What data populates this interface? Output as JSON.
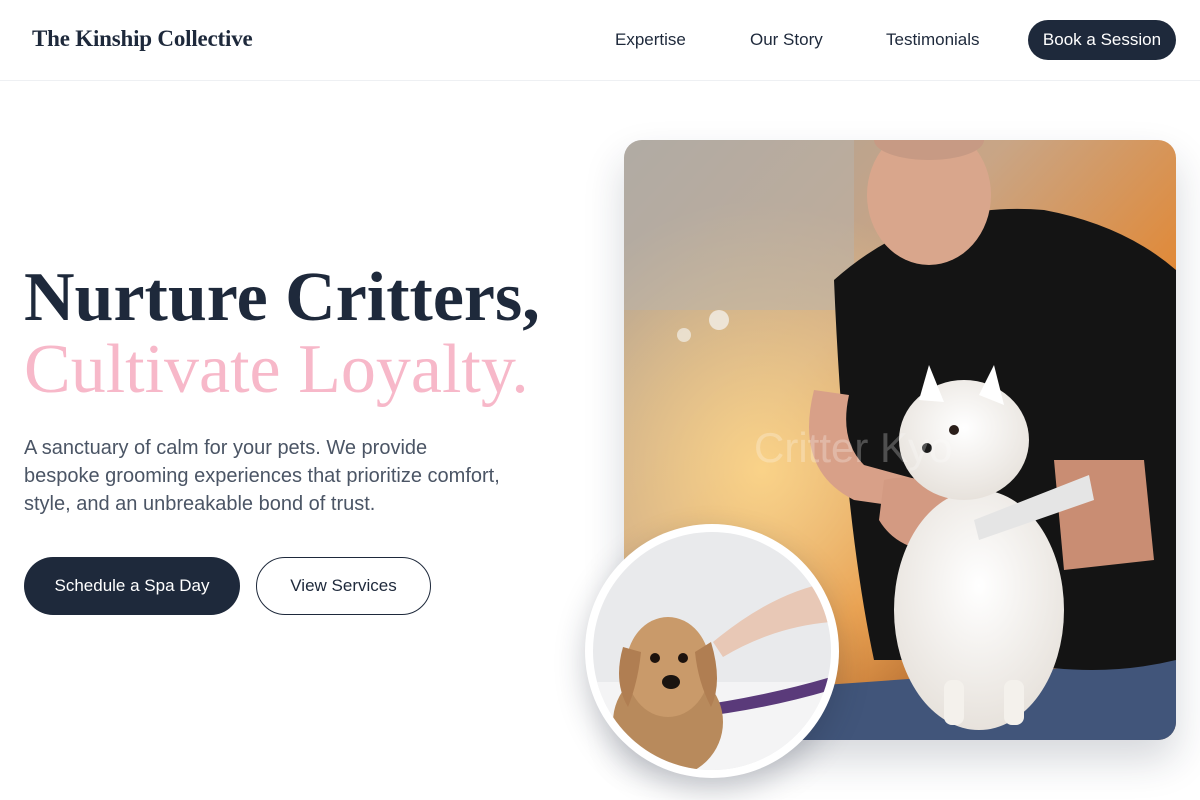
{
  "header": {
    "brand": "The Kinship Collective",
    "nav": {
      "expertise": "Expertise",
      "story": "Our Story",
      "testimonials": "Testimonials"
    },
    "cta": "Book a Session"
  },
  "hero": {
    "headline": "Nurture Critters,",
    "headline_accent": "Cultivate Loyalty.",
    "subtext": "A sanctuary of calm for your pets. We provide bespoke grooming experiences that prioritize comfort, style, and an unbreakable bond of trust.",
    "primary_button": "Schedule a Spa Day",
    "secondary_button": "View Services"
  },
  "colors": {
    "navy": "#1e293b",
    "accent_pink": "#f7b8c9",
    "body_text": "#4b5565"
  }
}
